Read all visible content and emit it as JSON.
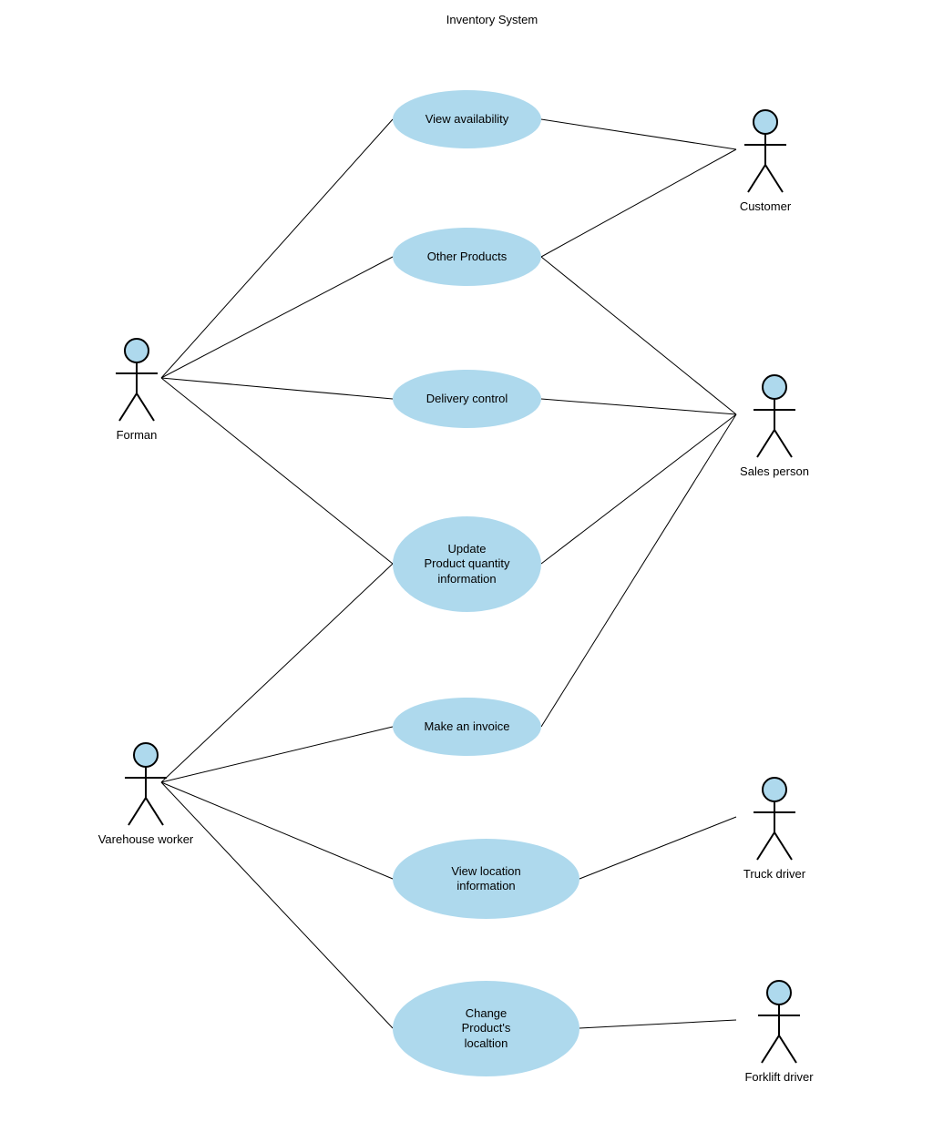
{
  "title": "Inventory System",
  "actors": {
    "forman": {
      "label": "Forman"
    },
    "customer": {
      "label": "Customer"
    },
    "sales": {
      "label": "Sales person"
    },
    "warehouse": {
      "label": "Varehouse worker"
    },
    "truck": {
      "label": "Truck driver"
    },
    "forklift": {
      "label": "Forklift driver"
    }
  },
  "usecases": {
    "view_availability": {
      "label": "View availability"
    },
    "other_products": {
      "label": "Other Products"
    },
    "delivery_control": {
      "label": "Delivery control"
    },
    "update_qty": {
      "label": "Update\nProduct quantity\ninformation"
    },
    "make_invoice": {
      "label": "Make an invoice"
    },
    "view_location": {
      "label": "View location\ninformation"
    },
    "change_location": {
      "label": "Change\nProduct's\nlocaltion"
    }
  },
  "connections": [
    [
      "forman",
      "view_availability"
    ],
    [
      "forman",
      "other_products"
    ],
    [
      "forman",
      "delivery_control"
    ],
    [
      "forman",
      "update_qty"
    ],
    [
      "customer",
      "view_availability"
    ],
    [
      "customer",
      "other_products"
    ],
    [
      "sales",
      "other_products"
    ],
    [
      "sales",
      "delivery_control"
    ],
    [
      "sales",
      "update_qty"
    ],
    [
      "sales",
      "make_invoice"
    ],
    [
      "warehouse",
      "update_qty"
    ],
    [
      "warehouse",
      "make_invoice"
    ],
    [
      "warehouse",
      "view_location"
    ],
    [
      "warehouse",
      "change_location"
    ],
    [
      "truck",
      "view_location"
    ],
    [
      "forklift",
      "change_location"
    ]
  ]
}
